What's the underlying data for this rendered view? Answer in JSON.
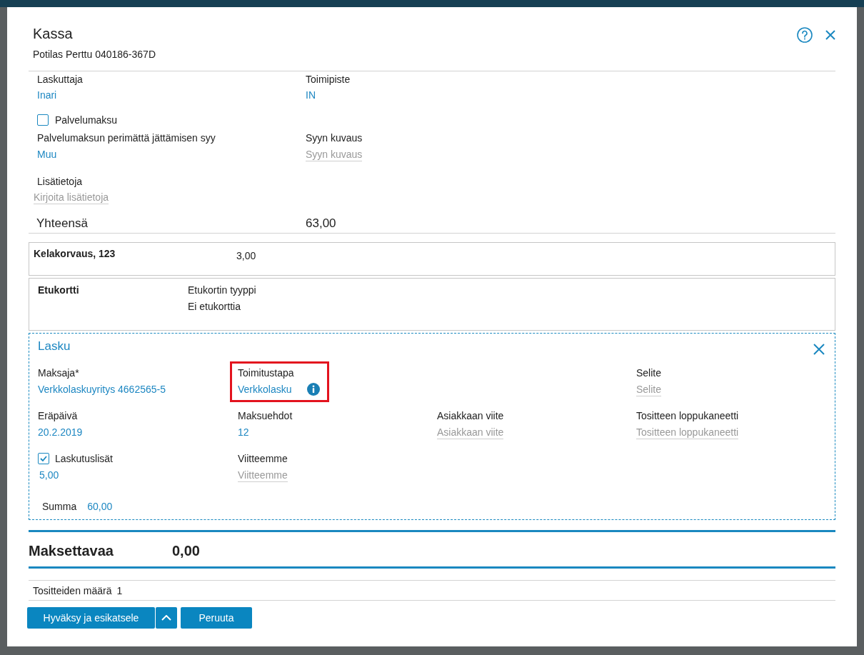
{
  "dialog": {
    "title": "Kassa",
    "subtitle": "Potilas Perttu 040186-367D"
  },
  "header_fields": [
    {
      "kind": "value",
      "label": "Laskuttaja",
      "value": "Inari"
    },
    {
      "kind": "value",
      "label": "Toimipiste",
      "value": "IN"
    }
  ],
  "service_fee": {
    "label": "Palvelumaksu",
    "checked": false
  },
  "reason_fields": [
    {
      "kind": "value",
      "label": "Palvelumaksun perimättä jättämisen syy",
      "value": "Muu"
    },
    {
      "kind": "input",
      "label": "Syyn kuvaus",
      "placeholder": "Syyn kuvaus"
    }
  ],
  "additional_info": {
    "label": "Lisätietoja",
    "placeholder": "Kirjoita lisätietoja"
  },
  "total": {
    "label": "Yhteensä",
    "value": "63,00"
  },
  "kela": {
    "label": "Kelakorvaus, 123",
    "value": "3,00"
  },
  "benefit_card": {
    "title": "Etukortti",
    "label": "Etukortin tyyppi",
    "value": "Ei etukorttia"
  },
  "invoice": {
    "title": "Lasku",
    "rows": [
      [
        {
          "kind": "value",
          "label": "Maksaja*",
          "value": "Verkkolaskuyritys 4662565-5"
        },
        {
          "kind": "value",
          "label": "Toimitustapa",
          "value": "Verkkolasku",
          "info": true,
          "highlighted": true
        },
        null,
        {
          "kind": "input",
          "label": "Selite",
          "placeholder": "Selite"
        }
      ],
      [
        {
          "kind": "value",
          "label": "Eräpäivä",
          "value": "20.2.2019"
        },
        {
          "kind": "value",
          "label": "Maksuehdot",
          "value": "12"
        },
        {
          "kind": "input",
          "label": "Asiakkaan viite",
          "placeholder": "Asiakkaan viite"
        },
        {
          "kind": "input",
          "label": "Tositteen loppukaneetti",
          "placeholder": "Tositteen loppukaneetti"
        }
      ],
      [
        {
          "kind": "checkbox",
          "label": "Laskutuslisät",
          "checked": true,
          "value": "5,00"
        },
        {
          "kind": "input",
          "label": "Viitteemme",
          "placeholder": "Viitteemme"
        }
      ]
    ],
    "sum": {
      "label": "Summa",
      "value": "60,00"
    }
  },
  "amount_due": {
    "label": "Maksettavaa",
    "value": "0,00"
  },
  "voucher_count": {
    "label": "Tositteiden määrä",
    "value": "1"
  },
  "buttons": [
    {
      "kind": "action",
      "label": "Hyväksy ja esikatsele"
    },
    {
      "kind": "menu"
    },
    {
      "kind": "action",
      "label": "Peruuta"
    }
  ]
}
